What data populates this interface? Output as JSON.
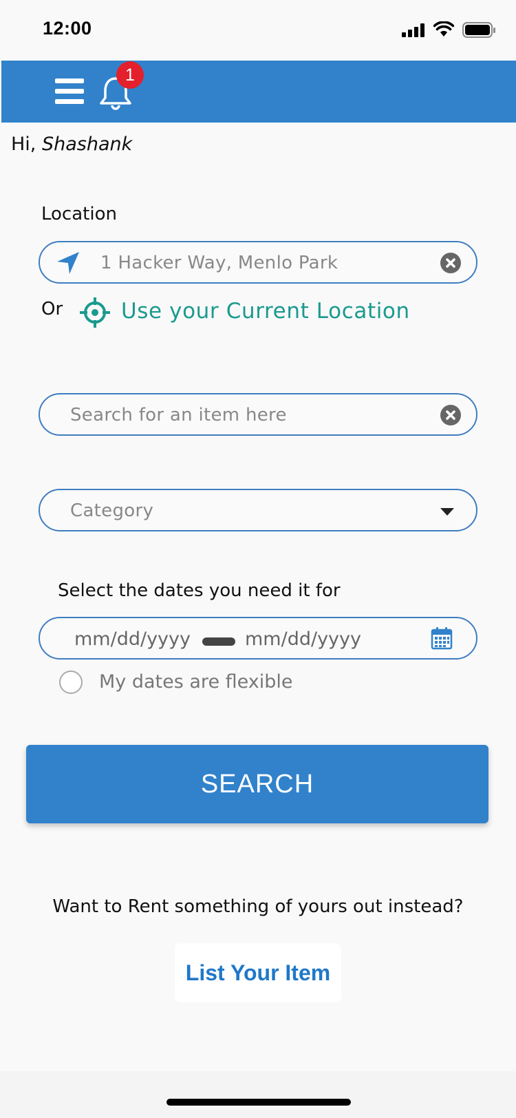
{
  "status_bar": {
    "time": "12:00"
  },
  "header": {
    "notification_count": "1",
    "accent_color": "#3182cb",
    "icons": [
      "menu-icon",
      "bell-icon"
    ]
  },
  "greeting": {
    "prefix": "Hi,",
    "name": "Shashank"
  },
  "location": {
    "label": "Location",
    "value": "1 Hacker Way, Menlo Park",
    "or_label": "Or",
    "current_location_label": "Use your Current Location",
    "link_color": "#1a9a8e"
  },
  "search": {
    "placeholder": "Search for an item here"
  },
  "category": {
    "placeholder": "Category"
  },
  "dates": {
    "label": "Select the dates you need it for",
    "start_placeholder": "mm/dd/yyyy",
    "end_placeholder": "mm/dd/yyyy",
    "flexible_label": "My dates are flexible",
    "flexible_checked": false
  },
  "search_button": {
    "label": "SEARCH"
  },
  "list_section": {
    "prompt": "Want to Rent something of yours out instead?",
    "button_label": "List Your Item",
    "button_color": "#1f78c8"
  }
}
